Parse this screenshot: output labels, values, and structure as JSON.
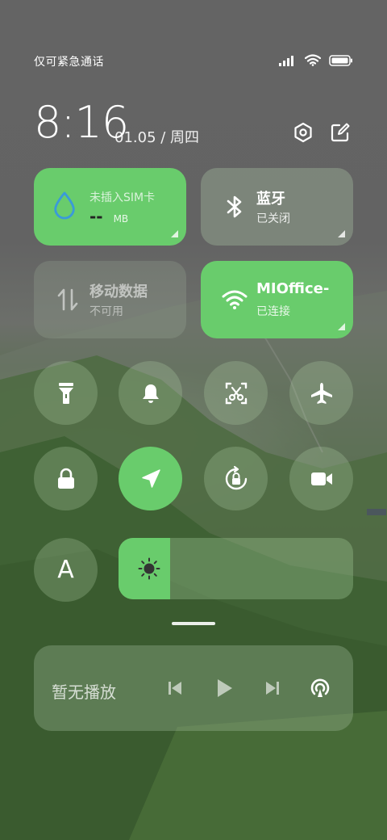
{
  "status_bar": {
    "carrier": "仅可紧急通话",
    "icons": [
      "signal-icon",
      "wifi-icon",
      "battery-icon"
    ]
  },
  "header": {
    "time": "8:16",
    "date": "01.05 / 周四",
    "buttons": [
      "settings-icon",
      "edit-icon"
    ]
  },
  "tiles": {
    "data_usage": {
      "title": "未插入SIM卡",
      "value": "-- ",
      "unit": "MB",
      "state": "on"
    },
    "bluetooth": {
      "title": "蓝牙",
      "status": "已关闭",
      "state": "off"
    },
    "mobile_data": {
      "title": "移动数据",
      "status": "不可用",
      "state": "disabled"
    },
    "wifi": {
      "title": "MIOffice-",
      "status": "已连接",
      "state": "on"
    }
  },
  "toggles": [
    {
      "name": "flashlight",
      "icon": "flashlight-icon",
      "state": "off"
    },
    {
      "name": "ringer",
      "icon": "bell-icon",
      "state": "off"
    },
    {
      "name": "screenshot",
      "icon": "scissors-icon",
      "state": "off"
    },
    {
      "name": "airplane-mode",
      "icon": "airplane-icon",
      "state": "off"
    },
    {
      "name": "lock-screen",
      "icon": "lock-icon",
      "state": "off"
    },
    {
      "name": "location",
      "icon": "location-arrow-icon",
      "state": "on"
    },
    {
      "name": "auto-rotate",
      "icon": "rotate-lock-icon",
      "state": "off"
    },
    {
      "name": "screen-record",
      "icon": "video-camera-icon",
      "state": "off"
    },
    {
      "name": "auto-brightness",
      "icon": "letter-a-icon",
      "label": "A",
      "state": "off"
    }
  ],
  "brightness": {
    "level": 0.22,
    "icon": "sun-icon"
  },
  "media": {
    "title": "暂无播放",
    "controls": [
      "previous-icon",
      "play-icon",
      "next-icon",
      "cast-icon"
    ]
  },
  "colors": {
    "accent": "#69cc6c",
    "tile_off": "rgba(165,190,160,0.38)"
  }
}
